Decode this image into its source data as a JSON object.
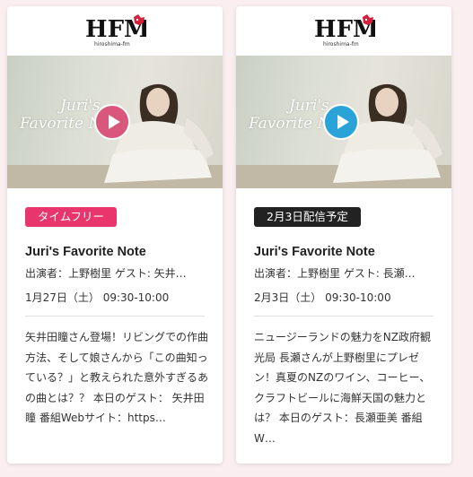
{
  "brand": {
    "logo_text": "HFM",
    "logo_sub": "hiroshima-fm"
  },
  "cards": [
    {
      "thumbnail_title_line1": "Juri's",
      "thumbnail_title_line2": "Favorite Note",
      "play_color": "#d9577a",
      "badge": "タイムフリー",
      "badge_color": "#e8356c",
      "title": "Juri's Favorite Note",
      "performer": "出演者：上野樹里 ゲスト: 矢井…",
      "datetime": "1月27日（土） 09:30-10:00",
      "description": "矢井田瞳さん登場！リビングでの作曲方法、そして娘さんから「この曲知っている？」と教えられた意外すぎるあの曲とは？？ 本日のゲスト： 矢井田瞳 番組Webサイト：https…"
    },
    {
      "thumbnail_title_line1": "Juri's",
      "thumbnail_title_line2": "Favorite Note",
      "play_color": "#2aa3d9",
      "badge": "2月3日配信予定",
      "badge_color": "#222222",
      "title": "Juri's Favorite Note",
      "performer": "出演者：上野樹里 ゲスト: 長瀬…",
      "datetime": "2月3日（土） 09:30-10:00",
      "description": "ニュージーランドの魅力をNZ政府観光局 長瀬さんが上野樹里にプレゼン！真夏のNZのワイン、コーヒー、クラフトビールに海鮮天国の魅力とは？ 本日のゲスト：長瀬亜美 番組W…"
    }
  ]
}
